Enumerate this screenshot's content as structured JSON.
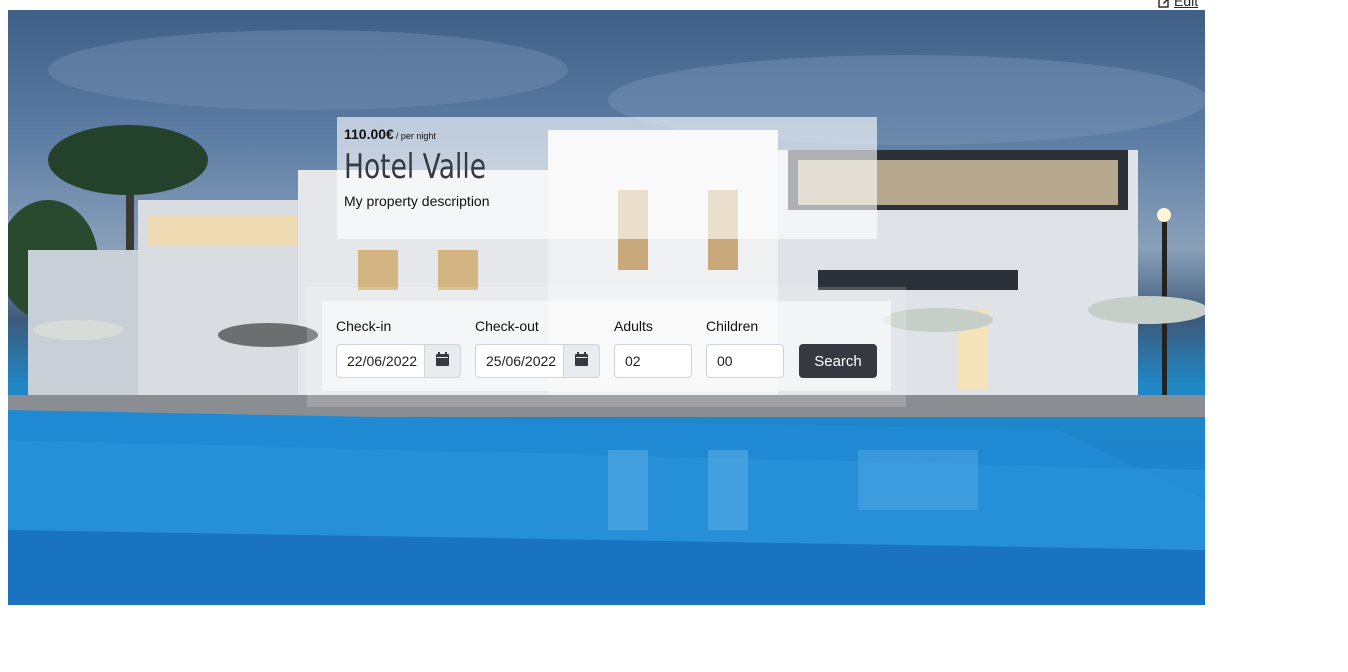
{
  "edit_link": {
    "label": "Edit",
    "icon": "edit-icon"
  },
  "hotel": {
    "price": "110.00€",
    "price_unit": "/ per night",
    "name": "Hotel Valle",
    "description": "My property description"
  },
  "search_form": {
    "checkin": {
      "label": "Check-in",
      "value": "22/06/2022",
      "icon": "calendar-icon"
    },
    "checkout": {
      "label": "Check-out",
      "value": "25/06/2022",
      "icon": "calendar-icon"
    },
    "adults": {
      "label": "Adults",
      "value": "02"
    },
    "children": {
      "label": "Children",
      "value": "00"
    },
    "search_label": "Search"
  },
  "colors": {
    "button": "#343a40",
    "pool": "#1d84cf",
    "sky": "#4a6d98"
  }
}
